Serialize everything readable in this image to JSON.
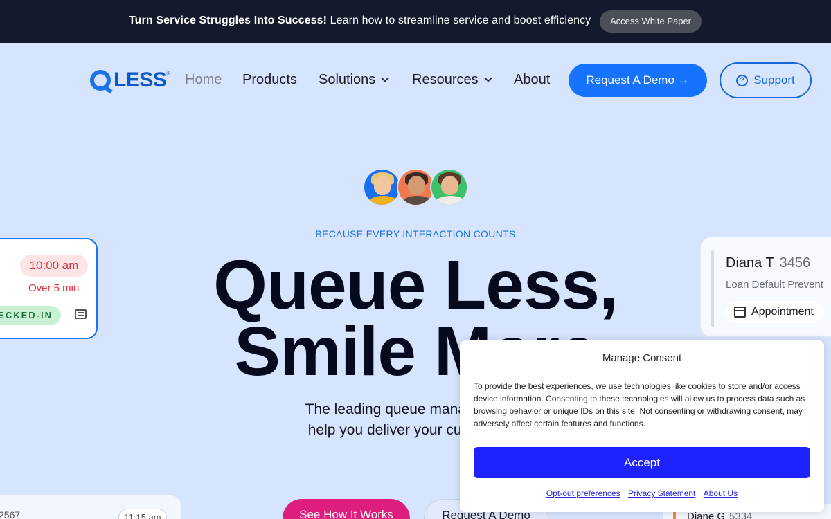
{
  "banner": {
    "headline": "Turn Service Struggles Into Success!",
    "text": "Learn how to streamline service and boost efficiency",
    "cta_label": "Access White Paper"
  },
  "brand": {
    "logo_text": "LESS",
    "registered": "®",
    "colors": {
      "primary": "#1673ff",
      "banner_bg": "#121a2c",
      "page_bg": "#d7e4fd",
      "pink": "#de1e7f"
    }
  },
  "nav": {
    "items": [
      {
        "label": "Home"
      },
      {
        "label": "Products"
      },
      {
        "label": "Solutions",
        "dropdown": true
      },
      {
        "label": "Resources",
        "dropdown": true
      },
      {
        "label": "About"
      }
    ],
    "demo_label": "Request A Demo →",
    "support_label": "Support"
  },
  "hero": {
    "eyebrow": "BECAUSE EVERY INTERACTION COUNTS",
    "headline_line1": "Queue Less,",
    "headline_line2": "Smile More",
    "sub_line1": "The leading queue management s",
    "sub_line2": "help you deliver your customer er",
    "primary_cta": "See How It Works",
    "secondary_cta": "Request A Demo"
  },
  "card_left": {
    "time": "10:00 am",
    "wait": "Over 5 min",
    "status": "ECKED-IN",
    "icon": "chat-icon"
  },
  "card_right": {
    "name": "Diana T",
    "number": "3456",
    "service": "Loan Default Prevent",
    "tag": "Appointment",
    "icon": "calendar-icon"
  },
  "card_bottom_left": {
    "number": "2567",
    "time": "11:15 am"
  },
  "card_bottom_right": {
    "name": "Diane G",
    "number": "5334"
  },
  "consent": {
    "title": "Manage Consent",
    "body": "To provide the best experiences, we use technologies like cookies to store and/or access device information. Consenting to these technologies will allow us to process data such as browsing behavior or unique IDs on this site. Not consenting or withdrawing consent, may adversely affect certain features and functions.",
    "accept_label": "Accept",
    "links": [
      "Opt-out preferences",
      "Privacy Statement",
      "About Us"
    ]
  }
}
